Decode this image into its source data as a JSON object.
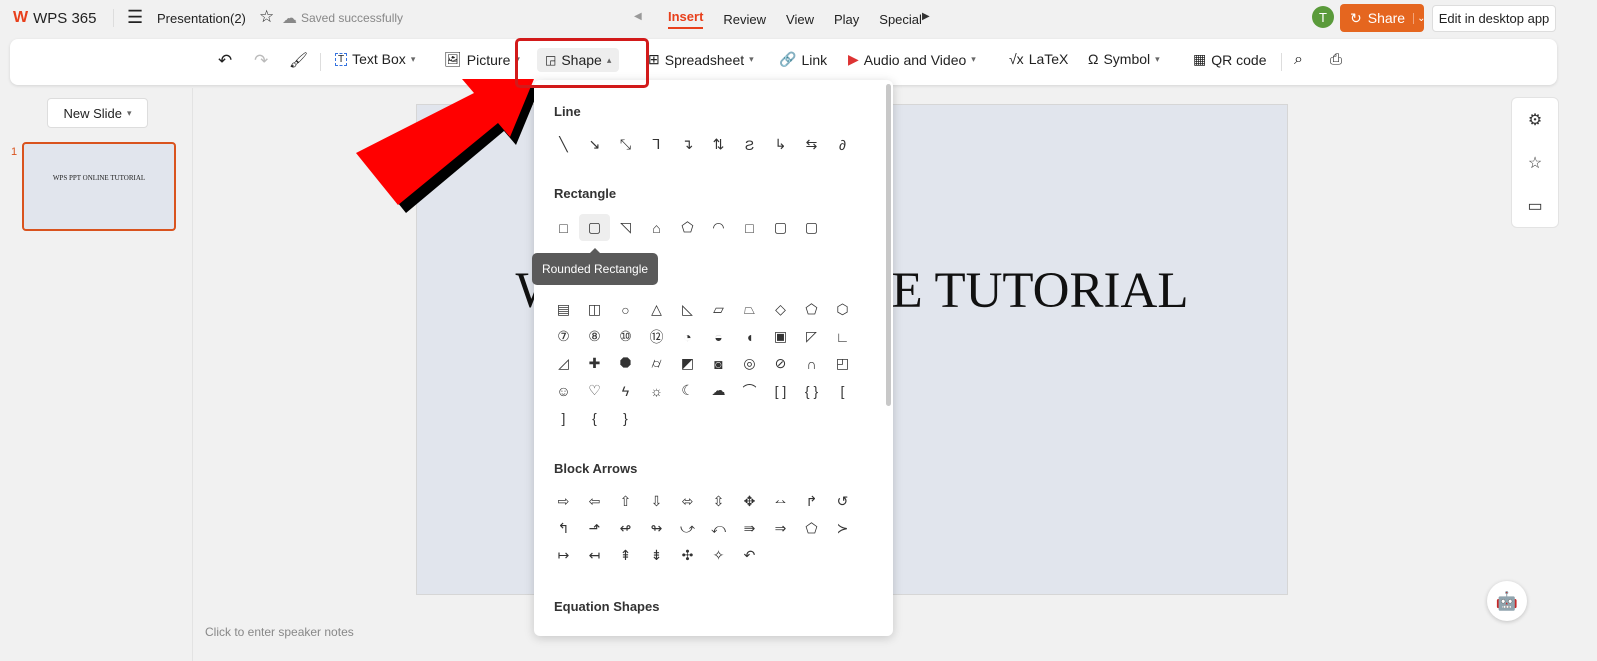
{
  "app": {
    "name": "WPS 365",
    "doc_title": "Presentation(2)",
    "save_status": "Saved successfully"
  },
  "menu_tabs": [
    "Insert",
    "Review",
    "View",
    "Play",
    "Special"
  ],
  "active_tab": "Insert",
  "user": {
    "initial": "T",
    "avatar_color": "#5a9a3a"
  },
  "share_label": "Share",
  "desktop_label": "Edit in desktop app",
  "toolbar": {
    "textbox": "Text Box",
    "picture": "Picture",
    "shape": "Shape",
    "spreadsheet": "Spreadsheet",
    "link": "Link",
    "audio_video": "Audio and Video",
    "latex": "LaTeX",
    "symbol": "Symbol",
    "qr": "QR code"
  },
  "new_slide": "New Slide",
  "slides": [
    {
      "number": "1",
      "title": "WPS PPT ONLINE TUTORIAL"
    }
  ],
  "slide_title": "WPS PPT ONLINE TUTORIAL",
  "notes_placeholder": "Click to enter speaker notes",
  "shape_menu": {
    "line": {
      "title": "Line",
      "glyphs": [
        "╲",
        "↘",
        "⤡",
        "⅂",
        "↴",
        "⇅",
        "Ƨ",
        "↳",
        "⇆",
        "∂"
      ]
    },
    "rectangle": {
      "title": "Rectangle",
      "glyphs": [
        "□",
        "▢",
        "◹",
        "⌂",
        "⬠",
        "◠",
        "□",
        "▢",
        "▢"
      ]
    },
    "basic": {
      "glyphs": [
        "▤",
        "◫",
        "○",
        "△",
        "◺",
        "▱",
        "⏢",
        "◇",
        "⬠",
        "⬡",
        "⑦",
        "⑧",
        "⑩",
        "⑫",
        "◔",
        "◒",
        "◖",
        "▣",
        "◸",
        "∟",
        "◿",
        "✚",
        "⯃",
        "⌭",
        "◩",
        "◙",
        "◎",
        "⊘",
        "∩",
        "◰",
        "☺",
        "♡",
        "ϟ",
        "☼",
        "☾",
        "☁",
        "⌒",
        "[ ]",
        "{ }",
        "[",
        "]",
        "{",
        "}"
      ]
    },
    "arrows": {
      "title": "Block Arrows",
      "glyphs": [
        "⇨",
        "⇦",
        "⇧",
        "⇩",
        "⬄",
        "⇳",
        "✥",
        "⥎",
        "↱",
        "↺",
        "↰",
        "⬏",
        "↫",
        "↬",
        "⤻",
        "⤺",
        "⇛",
        "⇒",
        "⬠",
        "≻",
        "↦",
        "↤",
        "⇞",
        "⇟",
        "✣",
        "✧",
        "↶"
      ]
    },
    "equation": {
      "title": "Equation Shapes"
    },
    "tooltip": "Rounded Rectangle"
  }
}
